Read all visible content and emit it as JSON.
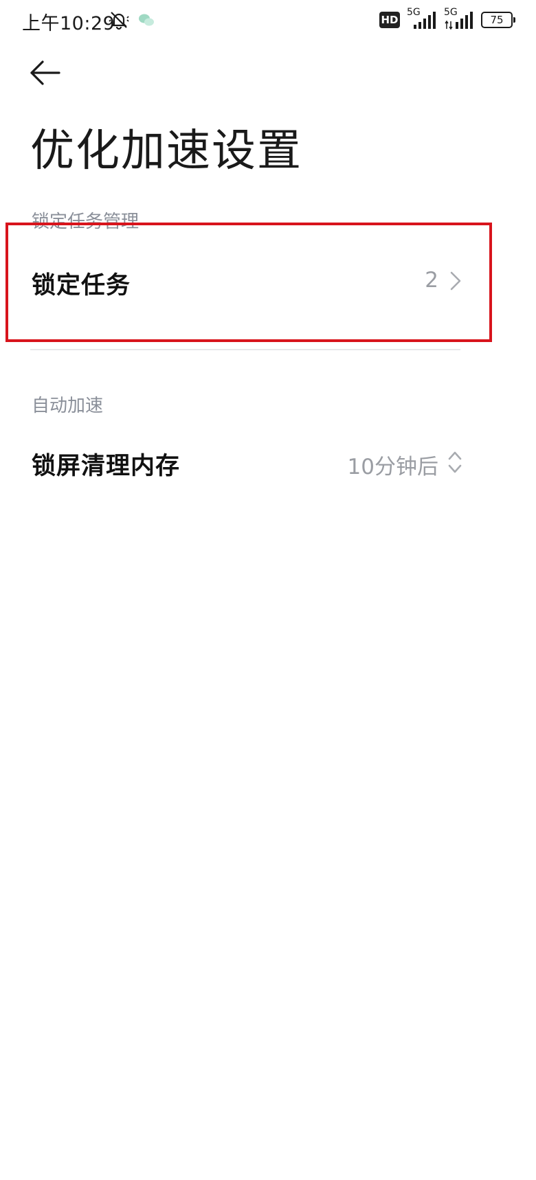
{
  "status_bar": {
    "time": "上午10:29",
    "network_1": "5G",
    "network_2": "5G",
    "hd_label": "HD",
    "battery": "75"
  },
  "header": {
    "title": "优化加速设置"
  },
  "sections": [
    {
      "label": "锁定任务管理",
      "rows": [
        {
          "title": "锁定任务",
          "value": "2",
          "accessory": "chevron-right-icon"
        }
      ]
    },
    {
      "label": "自动加速",
      "rows": [
        {
          "title": "锁屏清理内存",
          "value": "10分钟后",
          "accessory": "up-down-icon"
        }
      ]
    }
  ],
  "colors": {
    "highlight": "#d8141c",
    "section_label": "#8a8f99",
    "value_text": "#9a9da3"
  }
}
